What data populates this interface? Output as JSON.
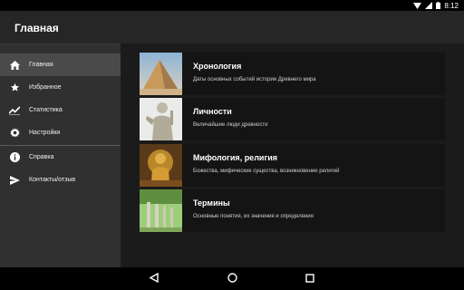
{
  "status": {
    "time": "8:12"
  },
  "appbar": {
    "title": "Главная"
  },
  "drawer": {
    "items": [
      {
        "label": "Главная",
        "icon": "home-icon"
      },
      {
        "label": "Избранное",
        "icon": "star-icon"
      },
      {
        "label": "Статистика",
        "icon": "chart-icon"
      },
      {
        "label": "Настройки",
        "icon": "gear-icon"
      },
      {
        "label": "Справка",
        "icon": "info-icon"
      },
      {
        "label": "Контакты/отзыв",
        "icon": "send-icon"
      }
    ]
  },
  "cards": [
    {
      "title": "Хронология",
      "subtitle": "Даты основных событий истории Древнего мира"
    },
    {
      "title": "Личности",
      "subtitle": "Величайшие люди древности"
    },
    {
      "title": "Мифология, религия",
      "subtitle": "Божества, мифические существа, возникновение религий"
    },
    {
      "title": "Термины",
      "subtitle": "Основные понятия, их значения и определения"
    }
  ],
  "colors": {
    "accent": "#4a4a4a",
    "appbar": "#262626",
    "drawer": "#303030",
    "card": "#141414"
  }
}
